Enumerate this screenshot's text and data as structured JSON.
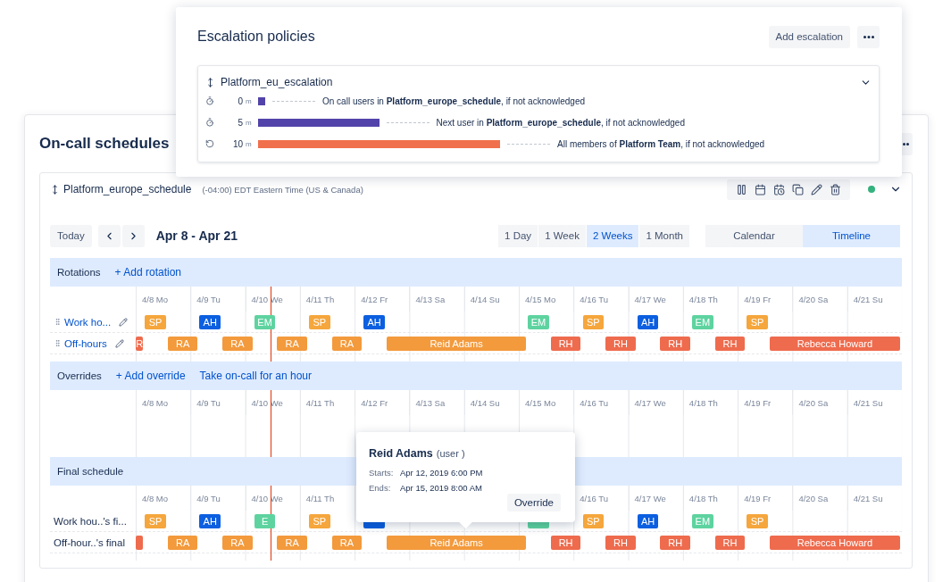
{
  "schedules_card": {
    "title": "On-call schedules",
    "schedule": {
      "name": "Platform_europe_schedule",
      "timezone": "(-04:00) EDT Eastern Time (US & Canada)",
      "enabled": true,
      "controls": {
        "today": "Today",
        "range": "Apr 8 - Apr 21",
        "spans": [
          {
            "label": "1 Day",
            "selected": false
          },
          {
            "label": "1 Week",
            "selected": false
          },
          {
            "label": "2 Weeks",
            "selected": true
          },
          {
            "label": "1 Month",
            "selected": false
          }
        ],
        "views": [
          {
            "label": "Calendar",
            "selected": false
          },
          {
            "label": "Timeline",
            "selected": true
          }
        ]
      },
      "timeline": {
        "now_line": {
          "level": 0.176
        },
        "sections": [
          {
            "title": "Rotations",
            "actions": [
              "+ Add rotation"
            ],
            "days": [
              "4/8 Mo",
              "4/9 Tu",
              "4/10 We",
              "4/11 Th",
              "4/12 Fr",
              "4/13 Sa",
              "4/14 Su",
              "4/15 Mo",
              "4/16 Tu",
              "4/17 We",
              "4/18 Th",
              "4/19 Fr",
              "4/20 Sa",
              "4/21 Su"
            ],
            "rows": [
              {
                "kind": "rotation",
                "label": "Work ho...",
                "shifts": [
                  {
                    "kind": "offnight"
                  },
                  {
                    "kind": "day",
                    "label": "SP",
                    "color": "#f5a63c"
                  },
                  {
                    "kind": "offnight"
                  },
                  {
                    "kind": "day",
                    "label": "AH",
                    "color": "#0b5fe0"
                  },
                  {
                    "kind": "offnight"
                  },
                  {
                    "kind": "day",
                    "label": "EM",
                    "color": "#5ed3a0"
                  },
                  {
                    "kind": "offnight"
                  },
                  {
                    "kind": "day",
                    "label": "SP",
                    "color": "#f5a63c"
                  },
                  {
                    "kind": "offnight"
                  },
                  {
                    "kind": "day",
                    "label": "AH",
                    "color": "#0b5fe0"
                  },
                  {
                    "kind": "offweekend"
                  },
                  {
                    "kind": "day",
                    "label": "EM",
                    "color": "#5ed3a0"
                  },
                  {
                    "kind": "offnight"
                  },
                  {
                    "kind": "day",
                    "label": "SP",
                    "color": "#f5a63c"
                  },
                  {
                    "kind": "offnight"
                  },
                  {
                    "kind": "day",
                    "label": "AH",
                    "color": "#0b5fe0"
                  },
                  {
                    "kind": "offnight"
                  },
                  {
                    "kind": "day",
                    "label": "EM",
                    "color": "#5ed3a0"
                  },
                  {
                    "kind": "offnight"
                  },
                  {
                    "kind": "day",
                    "label": "SP",
                    "color": "#f5a63c"
                  }
                ]
              },
              {
                "kind": "rotation",
                "label": "Off-hours",
                "shifts": [
                  {
                    "kind": "night",
                    "label": "R",
                    "color": "#ee6b4d"
                  },
                  {
                    "kind": "offday"
                  },
                  {
                    "kind": "night",
                    "label": "RA",
                    "color": "#f39a3c"
                  },
                  {
                    "kind": "offday"
                  },
                  {
                    "kind": "night",
                    "label": "RA",
                    "color": "#f39a3c"
                  },
                  {
                    "kind": "offday"
                  },
                  {
                    "kind": "night",
                    "label": "RA",
                    "color": "#f39a3c"
                  },
                  {
                    "kind": "offday"
                  },
                  {
                    "kind": "night",
                    "label": "RA",
                    "color": "#f39a3c"
                  },
                  {
                    "kind": "offday"
                  },
                  {
                    "kind": "weekend",
                    "label": "Reid Adams",
                    "color": "#f39a3c"
                  },
                  {
                    "kind": "offday"
                  },
                  {
                    "kind": "night",
                    "label": "RH",
                    "color": "#ee6b4d"
                  },
                  {
                    "kind": "offday"
                  },
                  {
                    "kind": "night",
                    "label": "RH",
                    "color": "#ee6b4d"
                  },
                  {
                    "kind": "offday"
                  },
                  {
                    "kind": "night",
                    "label": "RH",
                    "color": "#ee6b4d"
                  },
                  {
                    "kind": "offday"
                  },
                  {
                    "kind": "night",
                    "label": "RH",
                    "color": "#ee6b4d"
                  },
                  {
                    "kind": "offday"
                  },
                  {
                    "kind": "weekend",
                    "label": "Rebecca Howard",
                    "color": "#ee6b4d"
                  }
                ]
              }
            ]
          },
          {
            "title": "Overrides",
            "actions": [
              "+ Add override",
              "Take on-call for an hour"
            ],
            "days": [
              "4/8 Mo",
              "4/9 Tu",
              "4/10 We",
              "4/11 Th",
              "4/12 Fr",
              "4/13 Sa",
              "4/14 Su",
              "4/15 Mo",
              "4/16 Tu",
              "4/17 We",
              "4/18 Th",
              "4/19 Fr",
              "4/20 Sa",
              "4/21 Su"
            ]
          },
          {
            "title": "Final schedule",
            "days_before_tooltip": [
              "4/8 Mo",
              "4/9 Tu",
              "4/10 We",
              "4/11 Th"
            ],
            "days_after_tooltip": [
              "4/16 Tu",
              "4/17 We",
              "4/18 Th",
              "4/19 Fr",
              "4/20 Sa",
              "4/21 Su"
            ],
            "rows": [
              {
                "kind": "final",
                "label": "Work hou..'s fi...",
                "shifts": [
                  {
                    "kind": "offnight"
                  },
                  {
                    "kind": "day",
                    "label": "SP",
                    "color": "#f5a63c"
                  },
                  {
                    "kind": "offnight"
                  },
                  {
                    "kind": "day",
                    "label": "AH",
                    "color": "#0b5fe0"
                  },
                  {
                    "kind": "offnight"
                  },
                  {
                    "kind": "day",
                    "label": "E",
                    "color": "#5ed3a0"
                  },
                  {
                    "kind": "offnight"
                  },
                  {
                    "kind": "day",
                    "label": "SP",
                    "color": "#f5a63c"
                  },
                  {
                    "kind": "offnight"
                  },
                  {
                    "kind": "day",
                    "color": "#0b5fe0"
                  },
                  {
                    "kind": "offweekend"
                  },
                  {
                    "kind": "day",
                    "color": "#5ed3a0"
                  },
                  {
                    "kind": "offnight"
                  },
                  {
                    "kind": "day",
                    "label": "SP",
                    "color": "#f5a63c"
                  },
                  {
                    "kind": "offnight"
                  },
                  {
                    "kind": "day",
                    "label": "AH",
                    "color": "#0b5fe0"
                  },
                  {
                    "kind": "offnight"
                  },
                  {
                    "kind": "day",
                    "label": "EM",
                    "color": "#5ed3a0"
                  },
                  {
                    "kind": "offnight"
                  },
                  {
                    "kind": "day",
                    "label": "SP",
                    "color": "#f5a63c"
                  }
                ]
              },
              {
                "kind": "final",
                "label": "Off-hour..'s final",
                "shifts": [
                  {
                    "kind": "night",
                    "color": "#ee6b4d"
                  },
                  {
                    "kind": "offday"
                  },
                  {
                    "kind": "night",
                    "label": "RA",
                    "color": "#f39a3c"
                  },
                  {
                    "kind": "offday"
                  },
                  {
                    "kind": "night",
                    "label": "RA",
                    "color": "#f39a3c"
                  },
                  {
                    "kind": "offday"
                  },
                  {
                    "kind": "night",
                    "label": "RA",
                    "color": "#f39a3c"
                  },
                  {
                    "kind": "offday"
                  },
                  {
                    "kind": "night",
                    "label": "RA",
                    "color": "#f39a3c"
                  },
                  {
                    "kind": "offday"
                  },
                  {
                    "kind": "weekend",
                    "label": "Reid Adams",
                    "color": "#f39a3c"
                  },
                  {
                    "kind": "offday"
                  },
                  {
                    "kind": "night",
                    "label": "RH",
                    "color": "#ee6b4d"
                  },
                  {
                    "kind": "offday"
                  },
                  {
                    "kind": "night",
                    "label": "RH",
                    "color": "#ee6b4d"
                  },
                  {
                    "kind": "offday"
                  },
                  {
                    "kind": "night",
                    "label": "RH",
                    "color": "#ee6b4d"
                  },
                  {
                    "kind": "offday"
                  },
                  {
                    "kind": "night",
                    "label": "RH",
                    "color": "#ee6b4d"
                  },
                  {
                    "kind": "offday"
                  },
                  {
                    "kind": "weekend",
                    "label": "Rebecca Howard",
                    "color": "#ee6b4d"
                  }
                ]
              }
            ]
          }
        ]
      },
      "tooltip": {
        "name": "Reid Adams",
        "type": "(user )",
        "starts_label": "Starts:",
        "starts": "Apr 12, 2019 6:00 PM",
        "ends_label": "Ends:",
        "ends": "Apr 15, 2019 8:00 AM",
        "button": "Override"
      }
    }
  },
  "escalation_card": {
    "title": "Escalation policies",
    "add_button": "Add escalation",
    "policy": {
      "name": "Platform_eu_escalation",
      "steps": [
        {
          "kind": "wait",
          "delay": "0",
          "unit": "m",
          "color": "#5243aa",
          "text": "On call users in **Platform_europe_schedule**, if not acknowledged"
        },
        {
          "kind": "wait",
          "delay": "5",
          "unit": "m",
          "color": "#5243aa",
          "text": "Next user in **Platform_europe_schedule**, if not acknowledged"
        },
        {
          "kind": "repeat",
          "delay": "10",
          "unit": "m",
          "color": "#f0704d",
          "text": "All members of **Platform Team**, if not acknowledged"
        }
      ]
    }
  }
}
